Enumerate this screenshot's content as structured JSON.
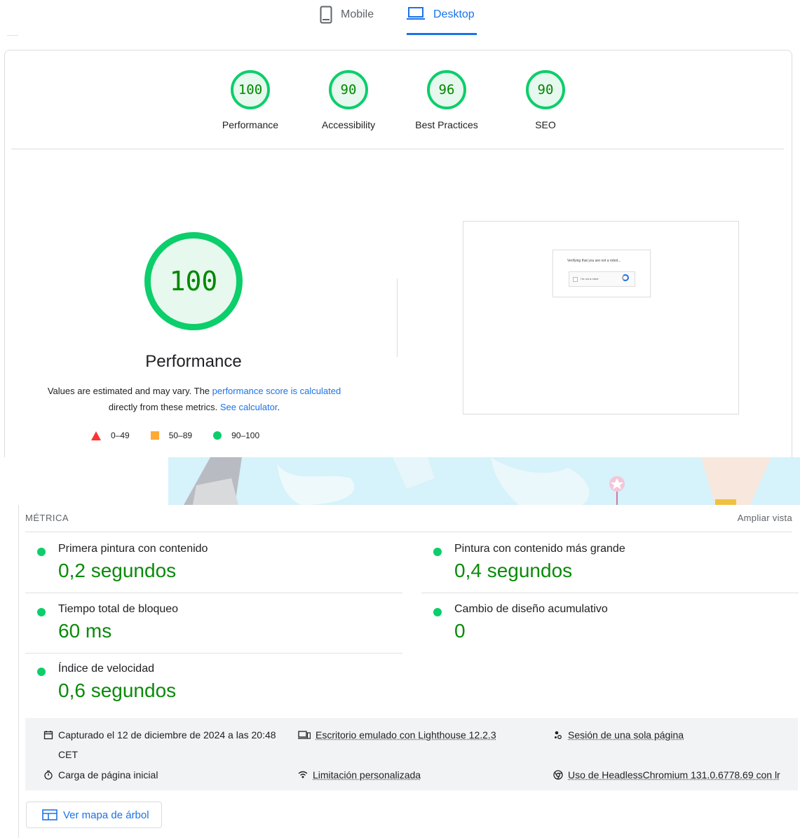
{
  "tabs": [
    {
      "label": "Mobile",
      "icon": "phone-icon"
    },
    {
      "label": "Desktop",
      "icon": "laptop-icon",
      "active": true
    }
  ],
  "categories": [
    {
      "score": "100",
      "label": "Performance",
      "color": "#0cce6b"
    },
    {
      "score": "90",
      "label": "Accessibility",
      "color": "#0cce6b"
    },
    {
      "score": "96",
      "label": "Best Practices",
      "color": "#0cce6b"
    },
    {
      "score": "90",
      "label": "SEO",
      "color": "#0cce6b"
    }
  ],
  "performance": {
    "score": "100",
    "title": "Performance",
    "desc_part1": "Values are estimated and may vary. The ",
    "desc_link1": "performance score is calculated",
    "desc_part2": " directly from these metrics. ",
    "desc_link2": "See calculator",
    "desc_part3": ".",
    "legend": [
      {
        "range": "0–49",
        "shape": "triangle",
        "color": "#ff3333"
      },
      {
        "range": "50–89",
        "shape": "square",
        "color": "#ffaa33"
      },
      {
        "range": "90–100",
        "shape": "circle",
        "color": "#0cce6b"
      }
    ]
  },
  "screenshot": {
    "captcha_title": "Verifying that you are not a robot...",
    "captcha_checkbox": "I'm not a robot"
  },
  "metrics": {
    "title": "MÉTRICA",
    "expand_label": "Ampliar vista",
    "items": [
      {
        "name": "Primera pintura con contenido",
        "value": "0,2 segundos"
      },
      {
        "name": "Pintura con contenido más grande",
        "value": "0,4 segundos"
      },
      {
        "name": "Tiempo total de bloqueo",
        "value": "60 ms"
      },
      {
        "name": "Cambio de diseño acumulativo",
        "value": "0"
      },
      {
        "name": "Índice de velocidad",
        "value": "0,6 segundos"
      }
    ]
  },
  "info": {
    "captured_line1": "Capturado el 12 de diciembre de 2024 a las 20:48",
    "captured_line2": "CET",
    "emulated": "Escritorio emulado con Lighthouse 12.2.3",
    "session": "Sesión de una sola página",
    "load": "Carga de página inicial",
    "throttling": "Limitación personalizada",
    "browser": "Uso de HeadlessChromium 131.0.6778.69 con lr"
  },
  "tree_button": "Ver mapa de árbol"
}
